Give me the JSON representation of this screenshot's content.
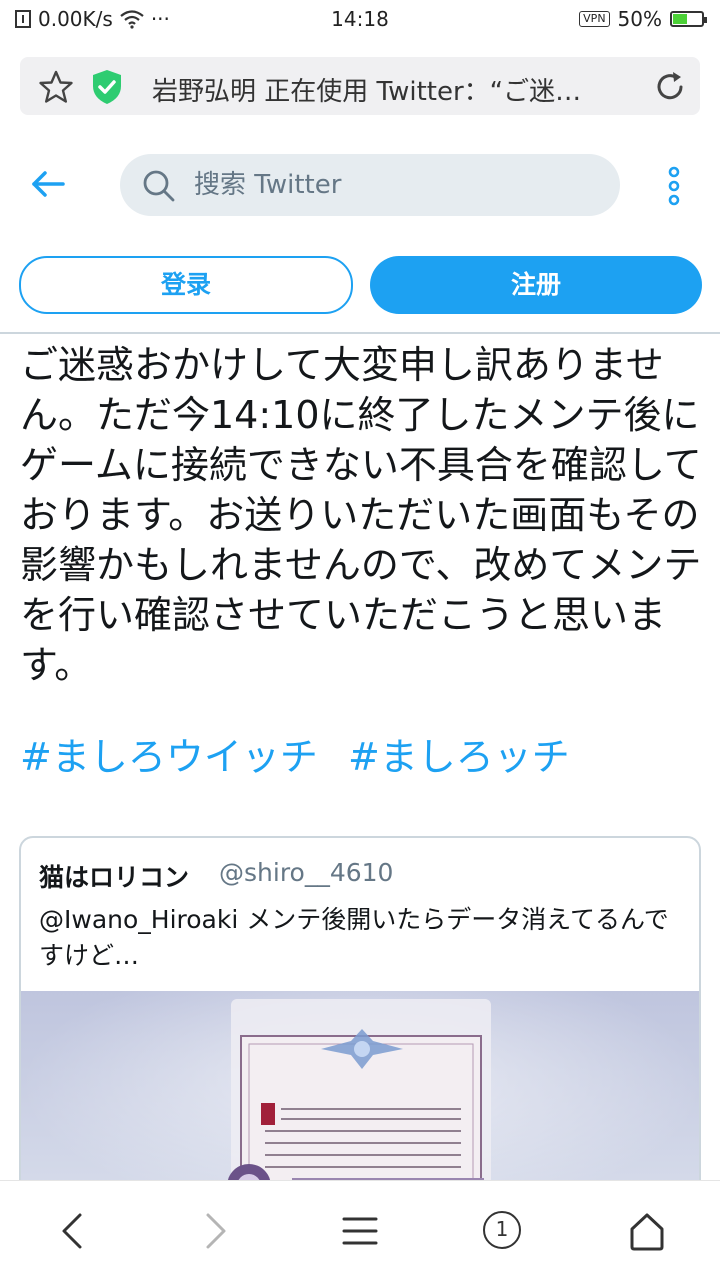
{
  "status_bar": {
    "speed": "0.00K/s",
    "dots": "···",
    "time": "14:18",
    "vpn": "VPN",
    "battery": "50%",
    "battery_level": 0.5
  },
  "address_bar": {
    "title": "岩野弘明 正在使用 Twitter：“ご迷…"
  },
  "header": {
    "search_placeholder": "搜索 Twitter",
    "login_label": "登录",
    "signup_label": "注册"
  },
  "tweet": {
    "text": "ご迷惑おかけして大変申し訳ありません。ただ今14:10に終了したメンテ後にゲームに接続できない不具合を確認しております。お送りいただいた画面もその影響かもしれませんので、改めてメンテを行い確認させていただこうと思います。",
    "hashtags": [
      "#ましろウイッチ",
      "#ましろッチ"
    ]
  },
  "quoted_tweet": {
    "name": "猫はロリコン",
    "handle": "@shiro__4610",
    "text": "@Iwano_Hiroaki メンテ後開いたらデータ消えてるんですけど…"
  },
  "nav": {
    "tab_count": "1"
  },
  "colors": {
    "twitter_blue": "#1da1f2",
    "shield_green": "#2ecc71",
    "battery_green": "#4cd137"
  }
}
